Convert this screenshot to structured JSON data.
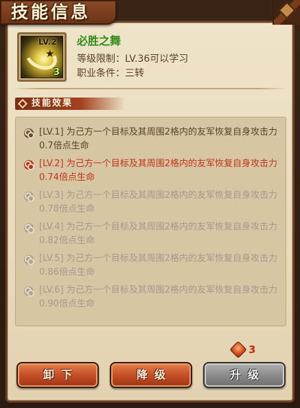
{
  "window": {
    "title": "技能信息"
  },
  "skill": {
    "icon_level": "LV.2",
    "icon_badge": "3",
    "name": "必胜之舞",
    "level_requirement": "等级限制：LV.36可以学习",
    "class_requirement": "职业条件：三转"
  },
  "effects": {
    "section_title": "技能效果",
    "items": [
      {
        "text": "[LV.1] 为己方一个目标及其周围2格内的友军恢复自身攻击力0.7倍点生命",
        "state": "learned"
      },
      {
        "text": "[LV.2] 为己方一个目标及其周围2格内的友军恢复自身攻击力0.74倍点生命",
        "state": "current"
      },
      {
        "text": "[LV.3] 为己方一个目标及其周围2格内的友军恢复自身攻击力0.78倍点生命",
        "state": "locked"
      },
      {
        "text": "[LV.4] 为己方一个目标及其周围2格内的友军恢复自身攻击力0.82倍点生命",
        "state": "locked"
      },
      {
        "text": "[LV.5] 为己方一个目标及其周围2格内的友军恢复自身攻击力0.86倍点生命",
        "state": "locked"
      },
      {
        "text": "[LV.6] 为己方一个目标及其周围2格内的友军恢复自身攻击力0.90倍点生命",
        "state": "locked"
      }
    ]
  },
  "cost": {
    "icon": "gem-icon",
    "value": "3"
  },
  "buttons": {
    "unequip": "卸下",
    "downgrade": "降级",
    "upgrade": "升级"
  },
  "colors": {
    "learned": "#5b4226",
    "current": "#c2331a",
    "locked": "#a6998a",
    "skill_name": "#2f8c17"
  }
}
